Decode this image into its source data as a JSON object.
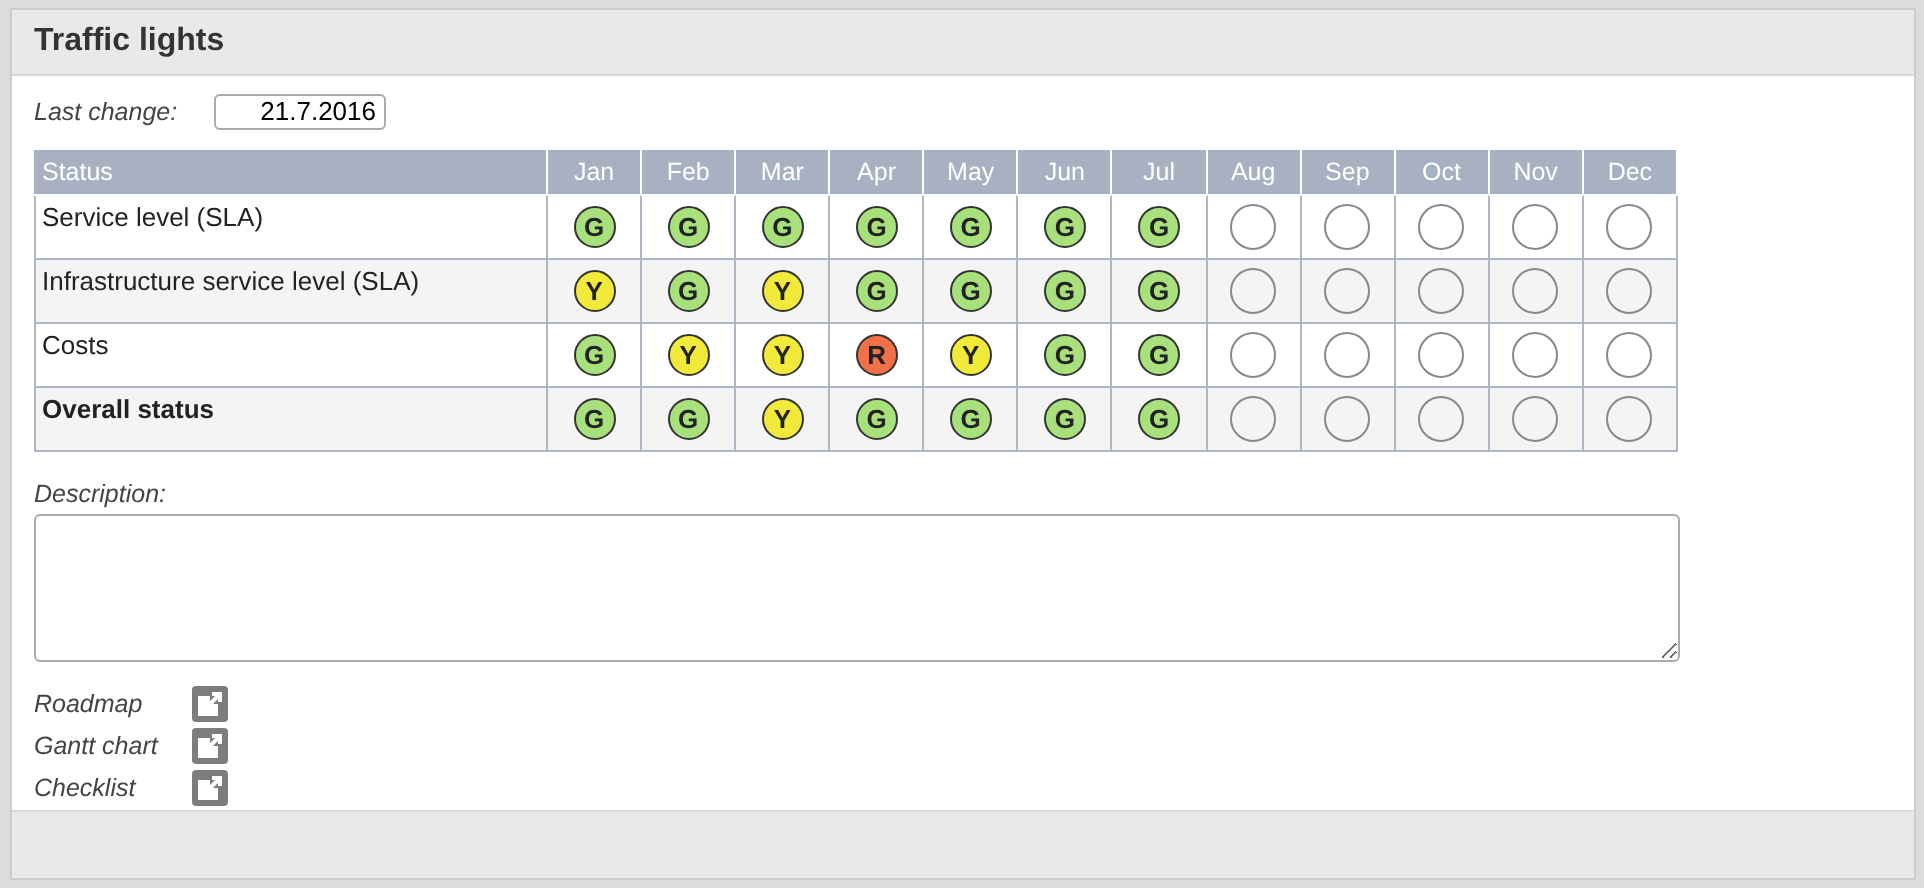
{
  "panel": {
    "title": "Traffic lights"
  },
  "last_change": {
    "label": "Last change:",
    "value": "21.7.2016"
  },
  "table": {
    "columns": [
      "Status",
      "Jan",
      "Feb",
      "Mar",
      "Apr",
      "May",
      "Jun",
      "Jul",
      "Aug",
      "Sep",
      "Oct",
      "Nov",
      "Dec"
    ],
    "rows": [
      {
        "bold": false,
        "cells": [
          {
            "kind": "label",
            "text": "Service level (SLA)"
          },
          {
            "kind": "light",
            "letter": "G",
            "color": "#a8e07c"
          },
          {
            "kind": "light",
            "letter": "G",
            "color": "#a8e07c"
          },
          {
            "kind": "light",
            "letter": "G",
            "color": "#a8e07c"
          },
          {
            "kind": "light",
            "letter": "G",
            "color": "#a8e07c"
          },
          {
            "kind": "light",
            "letter": "G",
            "color": "#a8e07c"
          },
          {
            "kind": "light",
            "letter": "G",
            "color": "#a8e07c"
          },
          {
            "kind": "light",
            "letter": "G",
            "color": "#a8e07c"
          },
          {
            "kind": "empty"
          },
          {
            "kind": "empty"
          },
          {
            "kind": "empty"
          },
          {
            "kind": "empty"
          },
          {
            "kind": "empty"
          }
        ]
      },
      {
        "bold": false,
        "cells": [
          {
            "kind": "label",
            "text": "Infrastructure service level (SLA)"
          },
          {
            "kind": "light",
            "letter": "Y",
            "color": "#f2ea3a"
          },
          {
            "kind": "light",
            "letter": "G",
            "color": "#a8e07c"
          },
          {
            "kind": "light",
            "letter": "Y",
            "color": "#f2ea3a"
          },
          {
            "kind": "light",
            "letter": "G",
            "color": "#a8e07c"
          },
          {
            "kind": "light",
            "letter": "G",
            "color": "#a8e07c"
          },
          {
            "kind": "light",
            "letter": "G",
            "color": "#a8e07c"
          },
          {
            "kind": "light",
            "letter": "G",
            "color": "#a8e07c"
          },
          {
            "kind": "empty"
          },
          {
            "kind": "empty"
          },
          {
            "kind": "empty"
          },
          {
            "kind": "empty"
          },
          {
            "kind": "empty"
          }
        ]
      },
      {
        "bold": false,
        "cells": [
          {
            "kind": "label",
            "text": "Costs"
          },
          {
            "kind": "light",
            "letter": "G",
            "color": "#a8e07c"
          },
          {
            "kind": "light",
            "letter": "Y",
            "color": "#f2ea3a"
          },
          {
            "kind": "light",
            "letter": "Y",
            "color": "#f2ea3a"
          },
          {
            "kind": "light",
            "letter": "R",
            "color": "#f07048"
          },
          {
            "kind": "light",
            "letter": "Y",
            "color": "#f2ea3a"
          },
          {
            "kind": "light",
            "letter": "G",
            "color": "#a8e07c"
          },
          {
            "kind": "light",
            "letter": "G",
            "color": "#a8e07c"
          },
          {
            "kind": "empty"
          },
          {
            "kind": "empty"
          },
          {
            "kind": "empty"
          },
          {
            "kind": "empty"
          },
          {
            "kind": "empty"
          }
        ]
      },
      {
        "bold": true,
        "cells": [
          {
            "kind": "label",
            "text": "Overall status"
          },
          {
            "kind": "light",
            "letter": "G",
            "color": "#a8e07c"
          },
          {
            "kind": "light",
            "letter": "G",
            "color": "#a8e07c"
          },
          {
            "kind": "light",
            "letter": "Y",
            "color": "#f2ea3a"
          },
          {
            "kind": "light",
            "letter": "G",
            "color": "#a8e07c"
          },
          {
            "kind": "light",
            "letter": "G",
            "color": "#a8e07c"
          },
          {
            "kind": "light",
            "letter": "G",
            "color": "#a8e07c"
          },
          {
            "kind": "light",
            "letter": "G",
            "color": "#a8e07c"
          },
          {
            "kind": "empty"
          },
          {
            "kind": "empty"
          },
          {
            "kind": "empty"
          },
          {
            "kind": "empty"
          },
          {
            "kind": "empty"
          }
        ]
      }
    ]
  },
  "description": {
    "label": "Description:"
  },
  "links": [
    {
      "label": "Roadmap"
    },
    {
      "label": "Gantt chart"
    },
    {
      "label": "Checklist"
    }
  ]
}
